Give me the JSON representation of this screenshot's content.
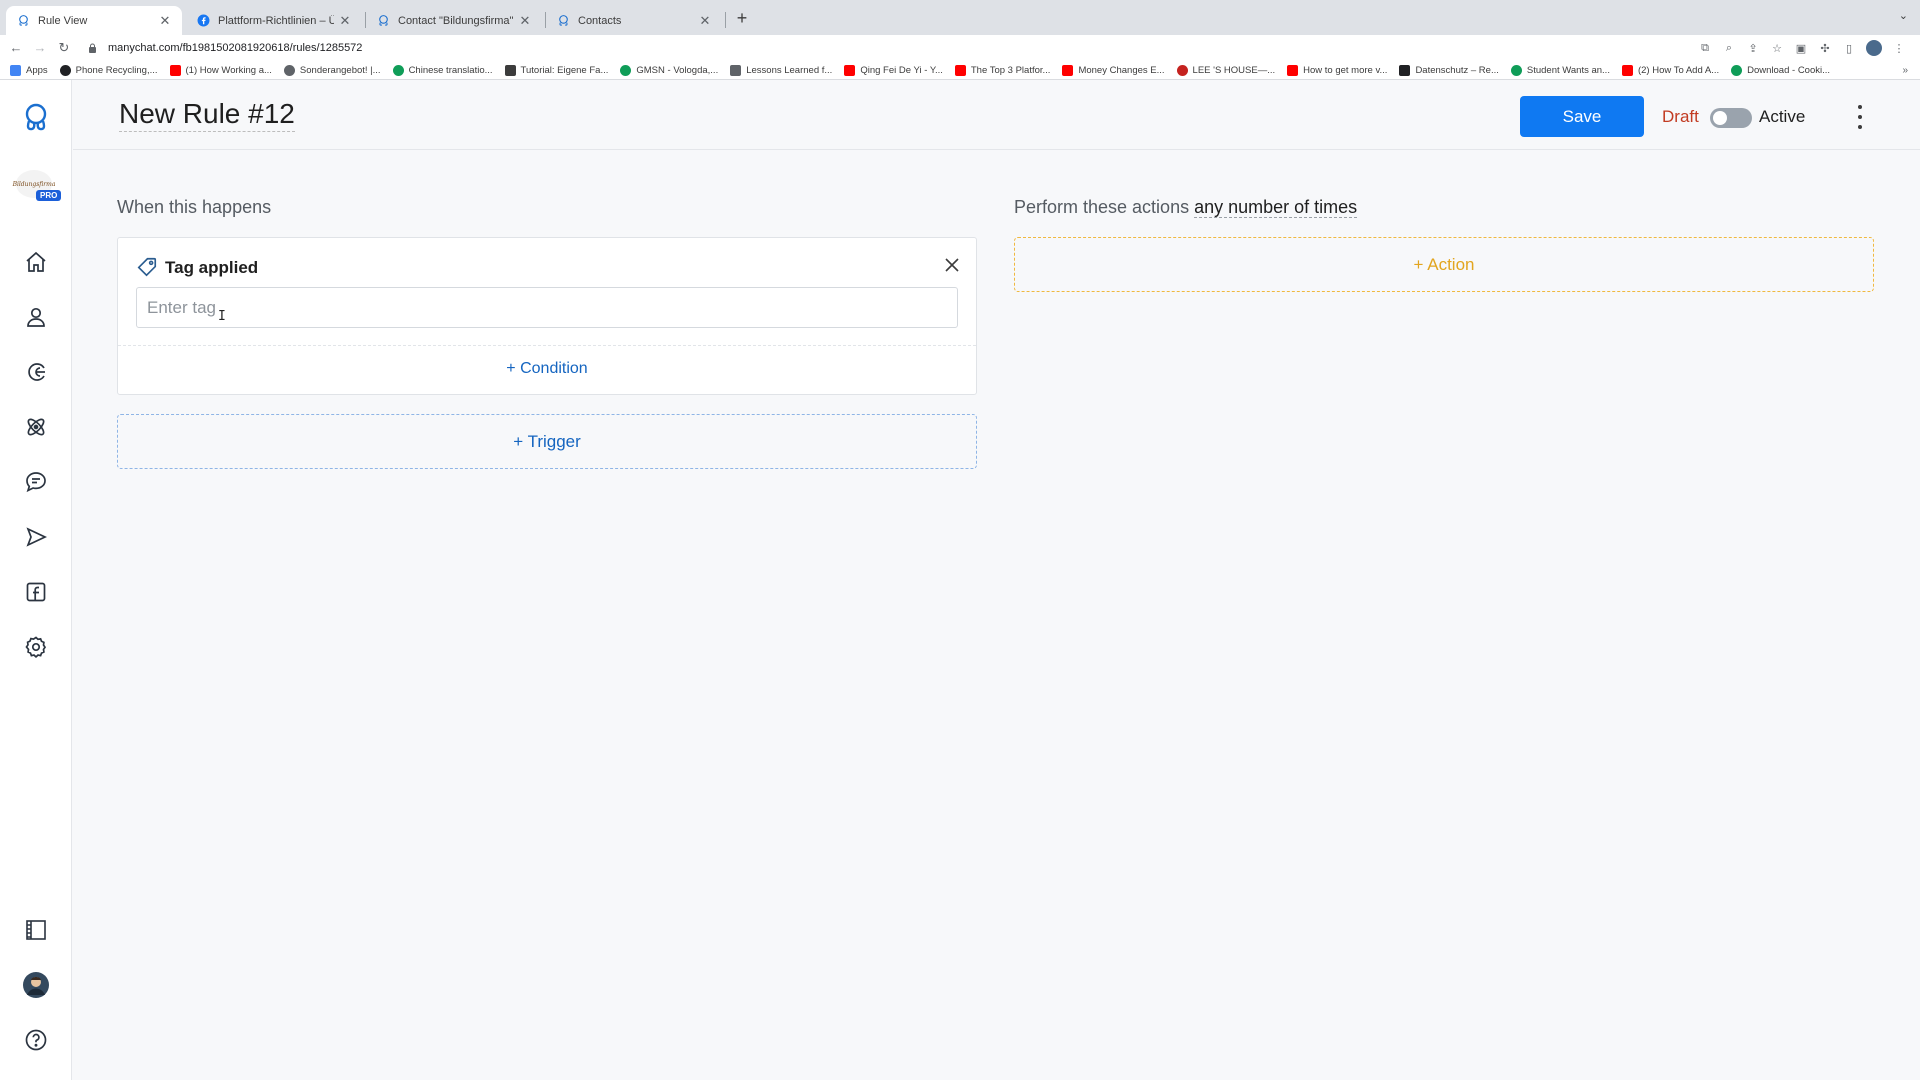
{
  "browser": {
    "tabs": [
      {
        "title": "Rule View",
        "active": true,
        "favicon": "manychat-icon"
      },
      {
        "title": "Plattform-Richtlinien – Übersicht",
        "active": false,
        "favicon": "facebook-icon"
      },
      {
        "title": "Contact \"Bildungsfirma\" through",
        "active": false,
        "favicon": "manychat-icon"
      },
      {
        "title": "Contacts",
        "active": false,
        "favicon": "manychat-icon"
      }
    ],
    "url": "manychat.com/fb198150208192061​8/rules/1285572",
    "bookmarks": [
      {
        "label": "Apps",
        "color": "#4285f4"
      },
      {
        "label": "Phone Recycling,...",
        "color": "#202124"
      },
      {
        "label": "(1) How Working a...",
        "color": "#ff0000"
      },
      {
        "label": "Sonderangebot! |...",
        "color": "#5f6368"
      },
      {
        "label": "Chinese translatio...",
        "color": "#0f9d58"
      },
      {
        "label": "Tutorial: Eigene Fa...",
        "color": "#3c3c3c"
      },
      {
        "label": "GMSN - Vologda,...",
        "color": "#0f9d58"
      },
      {
        "label": "Lessons Learned f...",
        "color": "#5f6368"
      },
      {
        "label": "Qing Fei De Yi - Y...",
        "color": "#ff0000"
      },
      {
        "label": "The Top 3 Platfor...",
        "color": "#ff0000"
      },
      {
        "label": "Money Changes E...",
        "color": "#ff0000"
      },
      {
        "label": "LEE 'S HOUSE—...",
        "color": "#c5221f"
      },
      {
        "label": "How to get more v...",
        "color": "#ff0000"
      },
      {
        "label": "Datenschutz – Re...",
        "color": "#202124"
      },
      {
        "label": "Student Wants an...",
        "color": "#0f9d58"
      },
      {
        "label": "(2) How To Add A...",
        "color": "#ff0000"
      },
      {
        "label": "Download - Cooki...",
        "color": "#0f9d58"
      }
    ]
  },
  "sidebar": {
    "account_badge": "PRO",
    "account_logo_text": "Bildungsfirma",
    "items": [
      {
        "name": "home"
      },
      {
        "name": "contacts"
      },
      {
        "name": "automation"
      },
      {
        "name": "growth-tools"
      },
      {
        "name": "live-chat"
      },
      {
        "name": "broadcasting"
      },
      {
        "name": "facebook-ads"
      },
      {
        "name": "settings"
      }
    ]
  },
  "header": {
    "rule_title": "New Rule #12",
    "save_label": "Save",
    "status_draft": "Draft",
    "status_active": "Active",
    "toggle_on": false
  },
  "trigger_section": {
    "heading": "When this happens",
    "trigger": {
      "icon": "tag-icon",
      "title": "Tag applied",
      "input_placeholder": "Enter tag",
      "input_value": ""
    },
    "add_condition_label": "+ Condition",
    "add_trigger_label": "+ Trigger"
  },
  "action_section": {
    "heading_prefix": "Perform these actions ",
    "frequency": "any number of times",
    "add_action_label": "+ Action"
  },
  "colors": {
    "primary": "#0f79f2",
    "link": "#1565c0",
    "draft": "#c23b22",
    "action_accent": "#f0b940"
  }
}
